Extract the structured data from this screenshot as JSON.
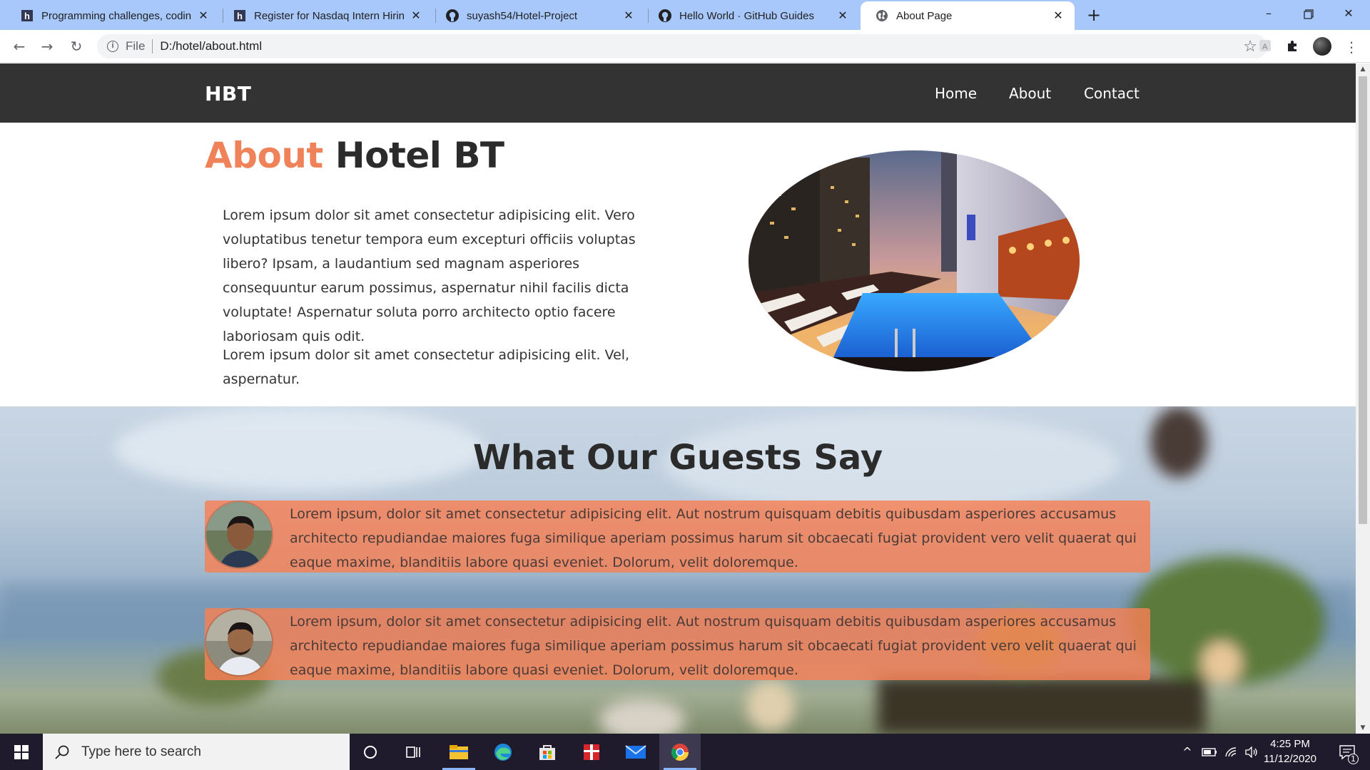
{
  "browser": {
    "tabs": [
      {
        "title": "Programming challenges, coding",
        "icon": "hackerearth-icon",
        "active": false
      },
      {
        "title": "Register for Nasdaq Intern Hiring",
        "icon": "hackerearth-icon",
        "active": false
      },
      {
        "title": "suyash54/Hotel-Project",
        "icon": "github-icon",
        "active": false
      },
      {
        "title": "Hello World · GitHub Guides",
        "icon": "github-icon",
        "active": false
      },
      {
        "title": "About Page",
        "icon": "globe-icon",
        "active": true
      }
    ],
    "address": {
      "scheme": "File",
      "url": "D:/hotel/about.html"
    }
  },
  "site": {
    "brand": "HBT",
    "nav": [
      "Home",
      "About",
      "Contact"
    ],
    "about": {
      "heading_accent": "About",
      "heading_rest": "Hotel BT",
      "paragraphs": [
        "Lorem ipsum dolor sit amet consectetur adipisicing elit. Vero voluptatibus tenetur tempora eum excepturi officiis voluptas libero? Ipsam, a laudantium sed magnam asperiores consequuntur earum possimus, aspernatur nihil facilis dicta voluptate! Aspernatur soluta porro architecto optio facere laboriosam quis odit.",
        "Lorem ipsum dolor sit amet consectetur adipisicing elit. Vel, aspernatur."
      ]
    },
    "guests": {
      "title": "What Our Guests Say",
      "testimonials": [
        {
          "text": "Lorem ipsum, dolor sit amet consectetur adipisicing elit. Aut nostrum quisquam debitis quibusdam asperiores accusamus architecto repudiandae maiores fuga similique aperiam possimus harum sit obcaecati fugiat provident vero velit quaerat qui eaque maxime, blanditiis labore quasi eveniet. Dolorum, velit doloremque."
        },
        {
          "text": "Lorem ipsum, dolor sit amet consectetur adipisicing elit. Aut nostrum quisquam debitis quibusdam asperiores accusamus architecto repudiandae maiores fuga similique aperiam possimus harum sit obcaecati fugiat provident vero velit quaerat qui eaque maxime, blanditiis labore quasi eveniet. Dolorum, velit doloremque."
        }
      ]
    }
  },
  "taskbar": {
    "search_placeholder": "Type here to search",
    "time": "4:25 PM",
    "date": "11/12/2020",
    "notification_count": "1"
  },
  "colors": {
    "accent": "#f0825a",
    "navbar": "#333333",
    "testimonial_bg": "#f68054",
    "chrome_tabstrip": "#a8c7fa",
    "taskbar": "#1f1b2c"
  }
}
